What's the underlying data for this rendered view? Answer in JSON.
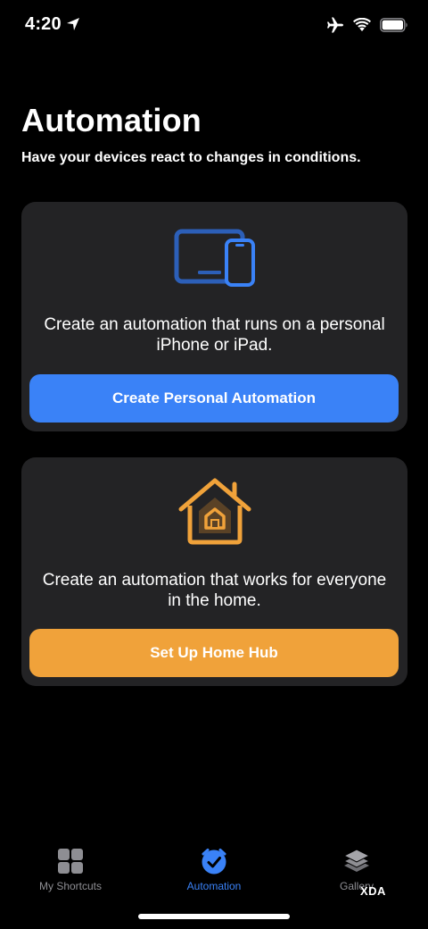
{
  "status_bar": {
    "time": "4:20",
    "icons": [
      "location-arrow-icon",
      "airplane-icon",
      "wifi-icon",
      "battery-icon"
    ]
  },
  "header": {
    "title": "Automation",
    "subtitle": "Have your devices react to changes in conditions."
  },
  "cards": {
    "personal": {
      "icon": "devices-icon",
      "description": "Create an automation that runs on a personal iPhone or iPad.",
      "button_label": "Create Personal Automation",
      "accent": "#3a82f7"
    },
    "home": {
      "icon": "home-icon",
      "description": "Create an automation that works for everyone in the home.",
      "button_label": "Set Up Home Hub",
      "accent": "#f0a23a"
    }
  },
  "tab_bar": {
    "tabs": [
      {
        "label": "My Shortcuts",
        "icon": "grid-icon",
        "selected": false
      },
      {
        "label": "Automation",
        "icon": "clock-check-icon",
        "selected": true
      },
      {
        "label": "Gallery",
        "icon": "layers-icon",
        "selected": false
      }
    ],
    "selected_color": "#3a82f7",
    "inactive_color": "#8e8e93"
  },
  "watermark": "XDA",
  "colors": {
    "background": "#000000",
    "card": "#232325"
  }
}
